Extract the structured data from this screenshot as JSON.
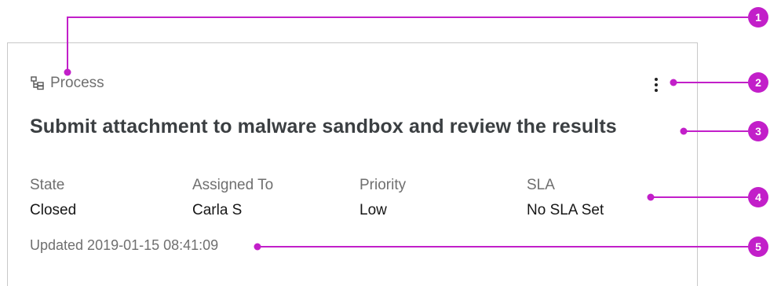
{
  "card": {
    "type_label": "Process",
    "title": "Submit attachment to malware sandbox and review the results",
    "fields": [
      {
        "label": "State",
        "value": "Closed"
      },
      {
        "label": "Assigned To",
        "value": "Carla S"
      },
      {
        "label": "Priority",
        "value": "Low"
      },
      {
        "label": "SLA",
        "value": "No SLA Set"
      }
    ],
    "updated": "Updated 2019-01-15 08:41:09"
  },
  "callouts": [
    "1",
    "2",
    "3",
    "4",
    "5"
  ],
  "colors": {
    "callout": "#c21fc9",
    "title": "#3b3f42",
    "muted": "#6f6f6f",
    "text": "#161616",
    "border": "#c8c8c8"
  },
  "icons": {
    "type": "process-tree-icon",
    "menu": "overflow-menu-vertical-icon"
  }
}
